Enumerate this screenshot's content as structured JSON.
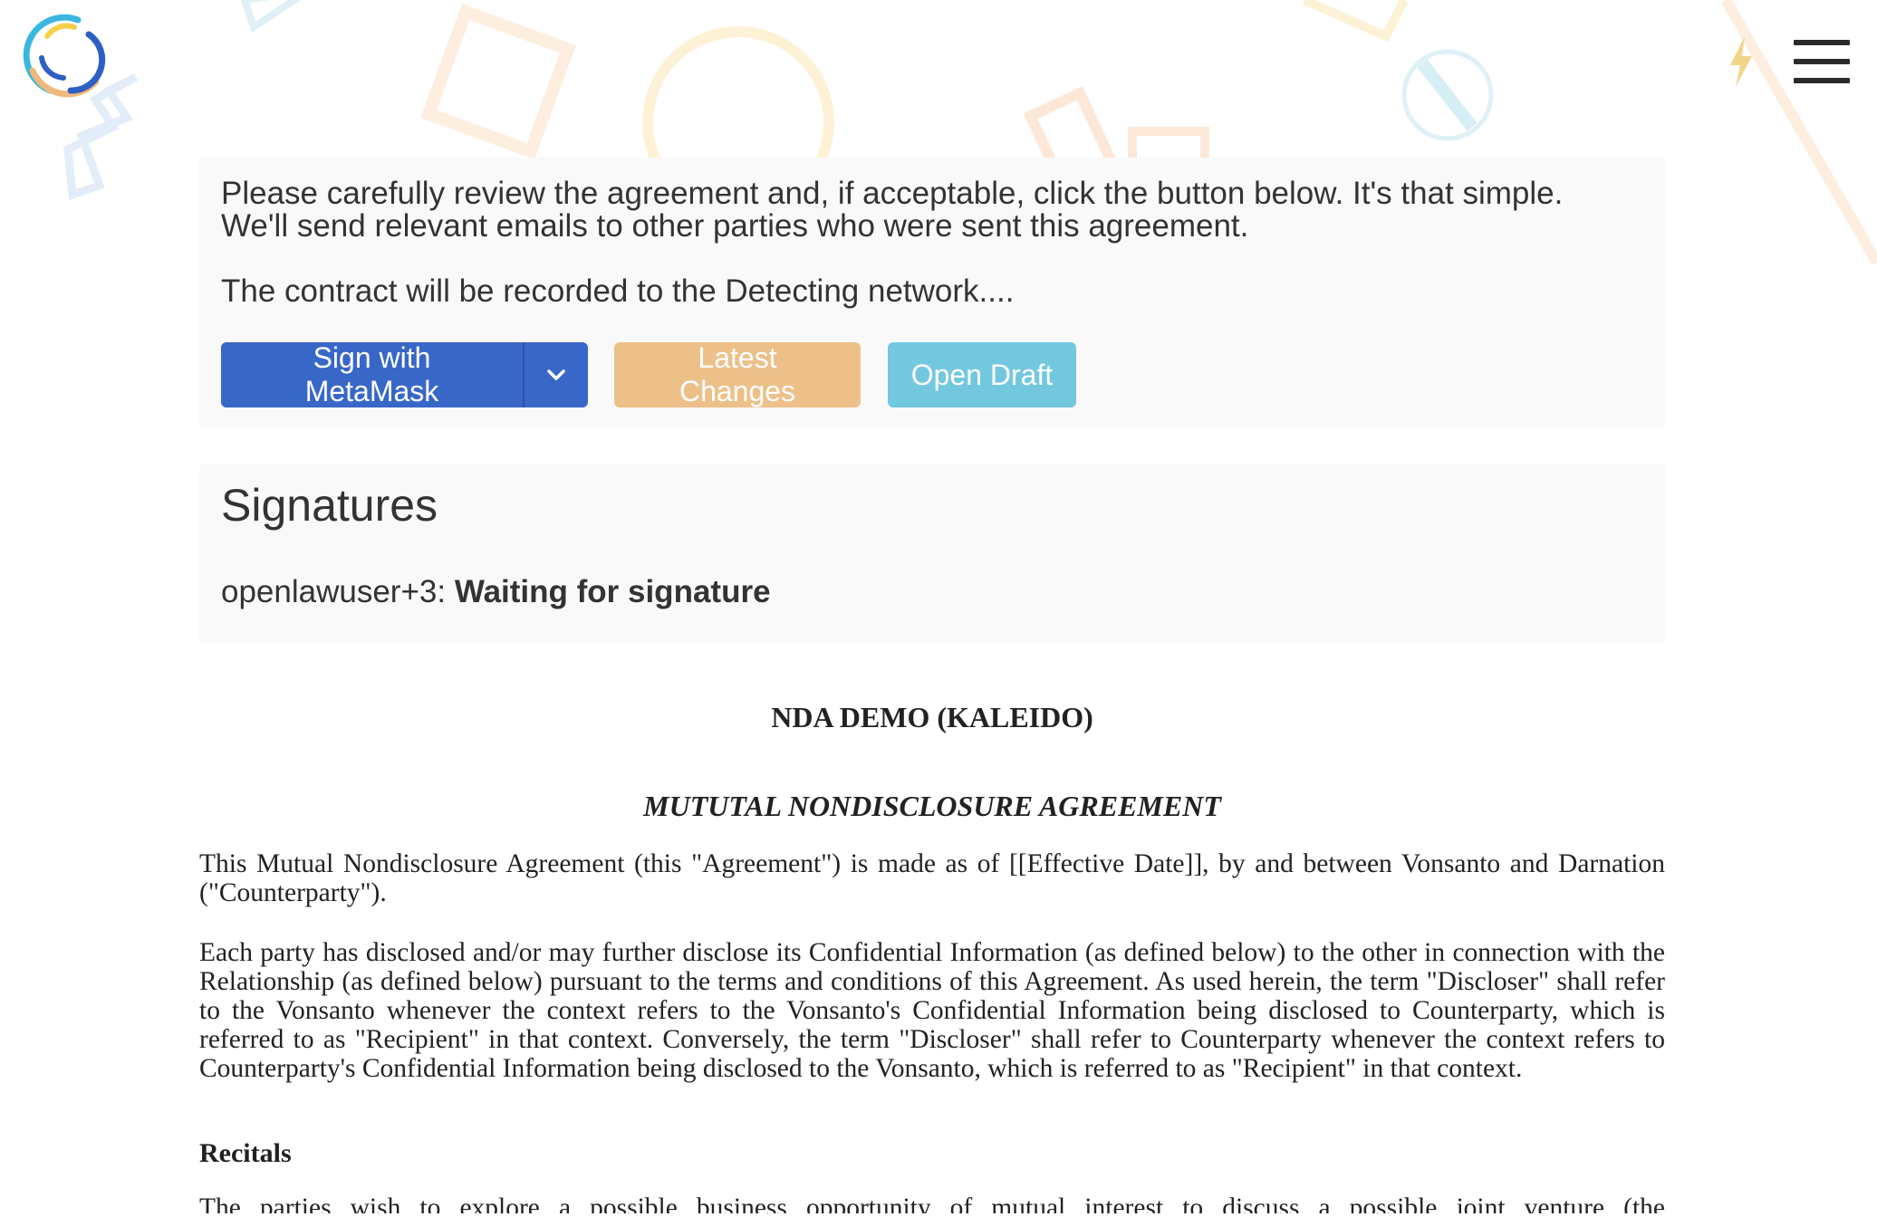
{
  "header": {
    "logo_icon": "openlaw-logo-icon",
    "bolt_icon": "lightning-bolt-icon",
    "menu_icon": "hamburger-menu-icon"
  },
  "review": {
    "line1": "Please carefully review the agreement and, if acceptable, click the button below. It's that simple.",
    "line2": "We'll send relevant emails to other parties who were sent this agreement.",
    "network": "The contract will be recorded to the Detecting network....",
    "buttons": {
      "sign": "Sign with MetaMask",
      "latest": "Latest Changes",
      "draft": "Open Draft"
    },
    "colors": {
      "sign": "#3867c8",
      "latest": "#edc08a",
      "draft": "#73c8e0"
    }
  },
  "signatures": {
    "title": "Signatures",
    "user": "openlawuser+3:",
    "status": "Waiting for signature"
  },
  "document": {
    "title": "NDA DEMO (KALEIDO)",
    "subtitle": "MUTUTAL NONDISCLOSURE AGREEMENT",
    "p1": "This Mutual Nondisclosure Agreement (this \"Agreement\") is made as of [[Effective Date]], by and between Vonsanto and Darnation (\"Counterparty\").",
    "p2": "Each party has disclosed and/or may further disclose its Confidential Information (as defined below) to the other in connection with the Relationship (as defined below) pursuant to the terms and conditions of this Agreement. As used herein, the term \"Discloser\" shall refer to the Vonsanto whenever the context refers to the Vonsanto's Confidential Information being disclosed to Counterparty, which is referred to as \"Recipient\" in that context. Conversely, the term \"Discloser\" shall refer to Counterparty whenever the context refers to Counterparty's Confidential Information being disclosed to the Vonsanto, which is referred to as \"Recipient\" in that context.",
    "recitals_heading": "Recitals",
    "p3": "The parties wish to explore a possible business opportunity of mutual interest to discuss a possible joint venture (the"
  }
}
